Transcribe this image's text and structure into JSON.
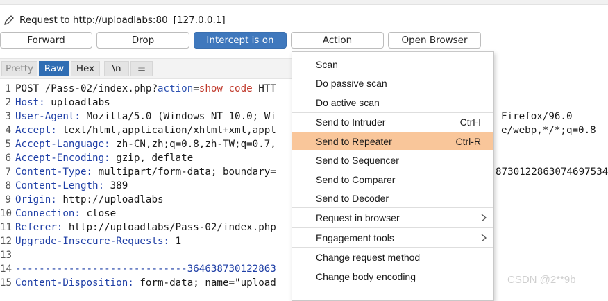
{
  "header": {
    "title": "Request to http://uploadlabs:80",
    "ip": "[127.0.0.1]"
  },
  "toolbar": {
    "forward": "Forward",
    "drop": "Drop",
    "intercept": "Intercept is on",
    "action": "Action",
    "open_browser": "Open Browser"
  },
  "view_modes": {
    "pretty": "Pretty",
    "raw": "Raw",
    "hex": "Hex",
    "newline": "\\n",
    "menu": "≡"
  },
  "request_lines": [
    {
      "n": "1",
      "k": "POST /Pass-02/index.php?",
      "pn": "action",
      "eq": "=",
      "pv": "show_code",
      "rest": " HTT"
    },
    {
      "n": "2",
      "k": "Host:",
      "v": " uploadlabs"
    },
    {
      "n": "3",
      "k": "User-Agent:",
      "v": " Mozilla/5.0 (Windows NT 10.0; Wi"
    },
    {
      "n": "4",
      "k": "Accept:",
      "v": " text/html,application/xhtml+xml,appl"
    },
    {
      "n": "5",
      "k": "Accept-Language:",
      "v": " zh-CN,zh;q=0.8,zh-TW;q=0.7,"
    },
    {
      "n": "6",
      "k": "Accept-Encoding:",
      "v": " gzip, deflate"
    },
    {
      "n": "7",
      "k": "Content-Type:",
      "v": " multipart/form-data; boundary="
    },
    {
      "n": "8",
      "k": "Content-Length:",
      "v": " 389"
    },
    {
      "n": "9",
      "k": "Origin:",
      "v": " http://uploadlabs"
    },
    {
      "n": "10",
      "k": "Connection:",
      "v": " close"
    },
    {
      "n": "11",
      "k": "Referer:",
      "v": " http://uploadlabs/Pass-02/index.php"
    },
    {
      "n": "12",
      "k": "Upgrade-Insecure-Requests:",
      "v": " 1"
    },
    {
      "n": "13",
      "k": "",
      "v": ""
    },
    {
      "n": "14",
      "k": "",
      "v": "-----------------------------364638730122863"
    },
    {
      "n": "15",
      "k": "Content-Disposition:",
      "v": " form-data; name=\"upload"
    }
  ],
  "overflow_right": {
    "line3": "Firefox/96.0",
    "line4": "e/webp,*/*;q=0.8",
    "line7": "8730122863074697534"
  },
  "context_menu": {
    "items": [
      {
        "label": "Scan",
        "shortcut": "",
        "submenu": false,
        "highlight": false
      },
      {
        "label": "Do passive scan",
        "shortcut": "",
        "submenu": false,
        "highlight": false
      },
      {
        "label": "Do active scan",
        "shortcut": "",
        "submenu": false,
        "highlight": false
      },
      {
        "label": "Send to Intruder",
        "shortcut": "Ctrl-I",
        "submenu": false,
        "highlight": false
      },
      {
        "label": "Send to Repeater",
        "shortcut": "Ctrl-R",
        "submenu": false,
        "highlight": true
      },
      {
        "label": "Send to Sequencer",
        "shortcut": "",
        "submenu": false,
        "highlight": false
      },
      {
        "label": "Send to Comparer",
        "shortcut": "",
        "submenu": false,
        "highlight": false
      },
      {
        "label": "Send to Decoder",
        "shortcut": "",
        "submenu": false,
        "highlight": false
      },
      {
        "label": "Request in browser",
        "shortcut": "",
        "submenu": true,
        "highlight": false
      },
      {
        "label": "Engagement tools",
        "shortcut": "",
        "submenu": true,
        "highlight": false
      },
      {
        "label": "Change request method",
        "shortcut": "",
        "submenu": false,
        "highlight": false
      },
      {
        "label": "Change body encoding",
        "shortcut": "",
        "submenu": false,
        "highlight": false
      }
    ]
  },
  "watermark": "CSDN @2**9b",
  "colors": {
    "accent": "#3f78bd",
    "raw_active": "#2f6db3",
    "menu_highlight": "#f9c69a",
    "param_value": "#c0392b",
    "header_key": "#1f3fa6"
  }
}
